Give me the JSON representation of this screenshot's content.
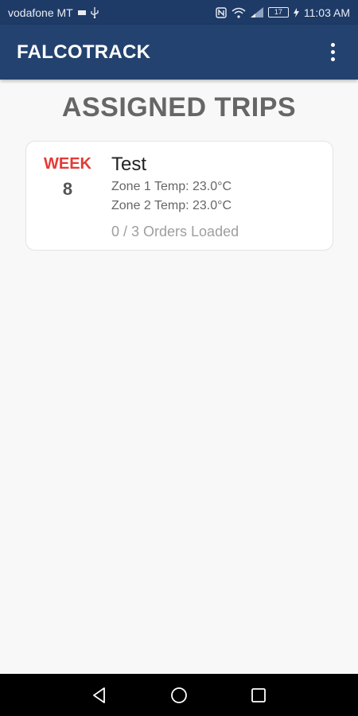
{
  "status_bar": {
    "carrier": "vodafone MT",
    "battery": "17",
    "time": "11:03 AM"
  },
  "app_bar": {
    "title": "FALCOTRACK",
    "menu_icon": "more-vert-icon"
  },
  "page": {
    "heading": "ASSIGNED TRIPS"
  },
  "trips": [
    {
      "week_label": "WEEK",
      "week_number": "8",
      "name": "Test",
      "zone1": "Zone 1 Temp: 23.0°C",
      "zone2": "Zone 2 Temp: 23.0°C",
      "orders": "0 / 3 Orders Loaded"
    }
  ],
  "nav_bar": {
    "back_icon": "back-icon",
    "home_icon": "home-icon",
    "recents_icon": "recents-icon"
  },
  "colors": {
    "app_bar": "#23426f",
    "status_bar": "#1e3a66",
    "week_accent": "#e53935",
    "background": "#f8f8f8"
  }
}
